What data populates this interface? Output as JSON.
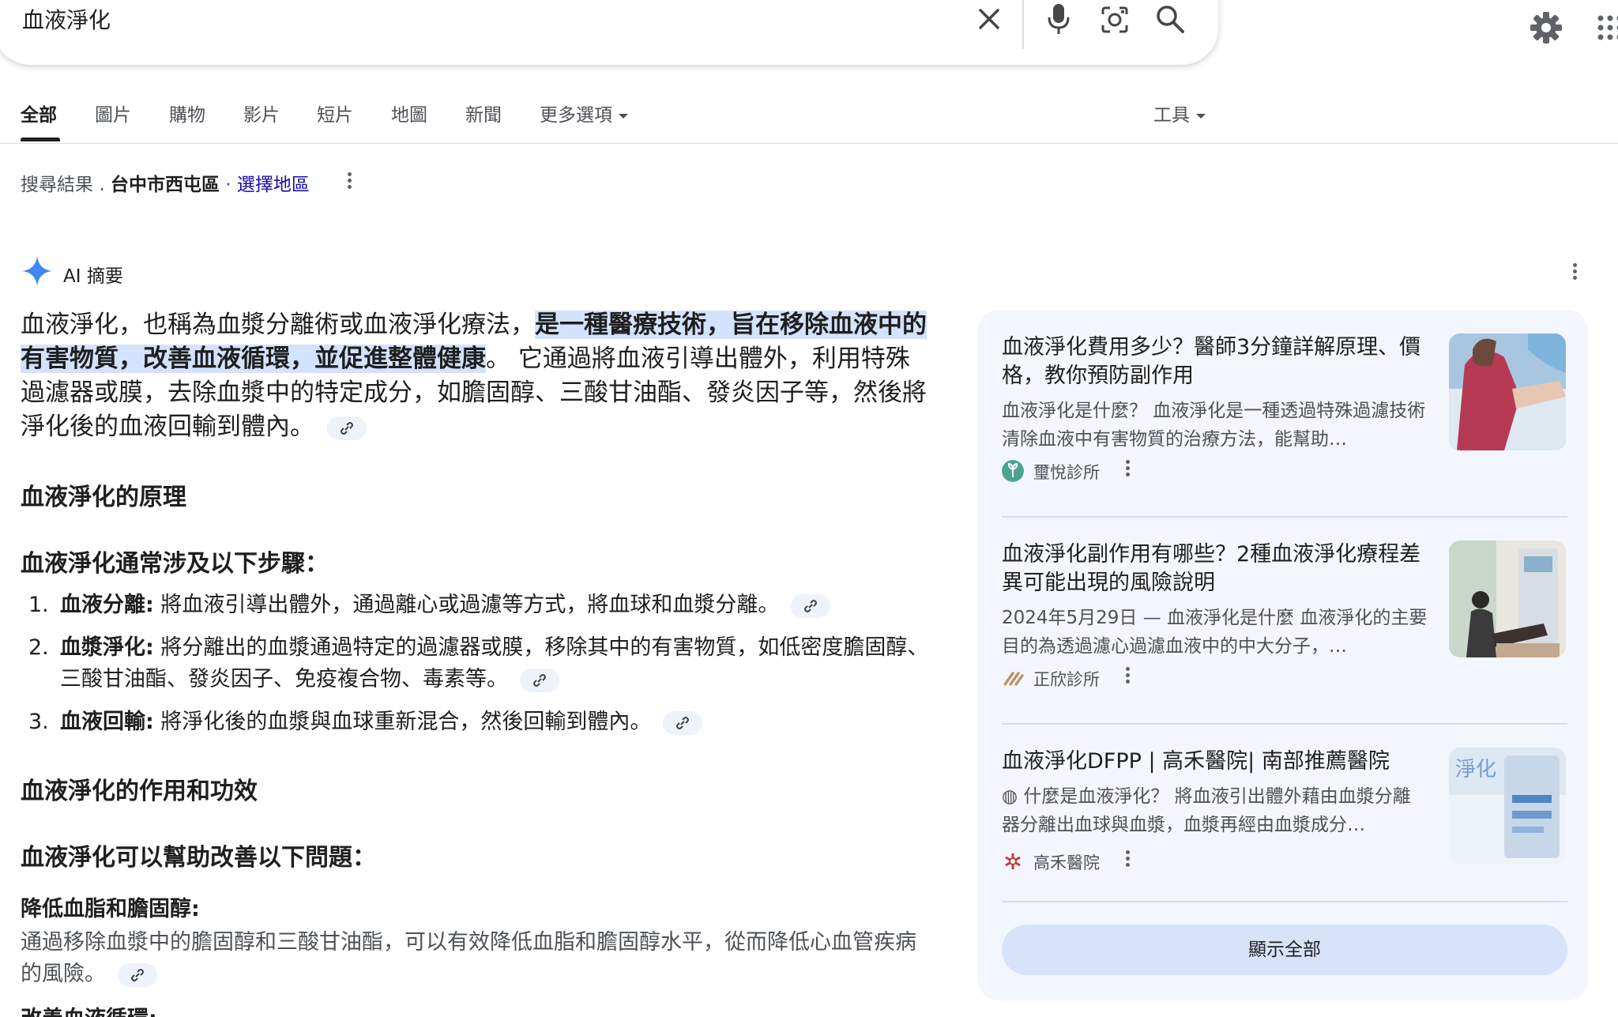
{
  "search": {
    "query": "血液淨化"
  },
  "tabs": [
    {
      "label": "全部"
    },
    {
      "label": "圖片"
    },
    {
      "label": "購物"
    },
    {
      "label": "影片"
    },
    {
      "label": "短片"
    },
    {
      "label": "地圖"
    },
    {
      "label": "新聞"
    },
    {
      "label": "更多選項"
    }
  ],
  "tools_label": "工具",
  "location": {
    "prefix": "搜尋結果",
    "sep": ".",
    "place": "台中市西屯區",
    "dot": "·",
    "choose": "選擇地區"
  },
  "ai_overview": {
    "title": "AI 摘要",
    "intro_a": "血液淨化，也稱為血漿分離術或血液淨化療法，",
    "intro_hl": "是一種醫療技術，旨在移除血液中的有害物質，改善血液循環，並促進整體健康",
    "intro_b": "。 它通過將血液引導出體外，利用特殊過濾器或膜，去除血漿中的特定成分，如膽固醇、三酸甘油酯、發炎因子等，然後將淨化後的血液回輸到體內。",
    "section1": "血液淨化的原理",
    "section1_sub": "血液淨化通常涉及以下步驟：",
    "steps": [
      {
        "num": "1.",
        "term": "血液分離:",
        "text": " 將血液引導出體外，通過離心或過濾等方式，將血球和血漿分離。"
      },
      {
        "num": "2.",
        "term": "血漿淨化:",
        "text": " 將分離出的血漿通過特定的過濾器或膜，移除其中的有害物質，如低密度膽固醇、三酸甘油酯、發炎因子、免疫複合物、毒素等。"
      },
      {
        "num": "3.",
        "term": "血液回輸:",
        "text": " 將淨化後的血漿與血球重新混合，然後回輸到體內。"
      }
    ],
    "section2": "血液淨化的作用和功效",
    "section2_sub": "血液淨化可以幫助改善以下問題：",
    "benefit1_title": "降低血脂和膽固醇:",
    "benefit1_text": "通過移除血漿中的膽固醇和三酸甘油酯，可以有效降低血脂和膽固醇水平，從而降低心血管疾病的風險。",
    "benefit2_title": "改善血液循環:"
  },
  "sources": [
    {
      "title": "血液淨化費用多少？醫師3分鐘詳解原理、價格，教你預防副作用",
      "snippet": "血液淨化是什麼？ 血液淨化是一種透過特殊過濾技術清除血液中有害物質的治療方法，能幫助…",
      "source": "璽悅診所",
      "icon": "leaf-logo-icon"
    },
    {
      "title": "血液淨化副作用有哪些？2種血液淨化療程差異可能出現的風險說明",
      "snippet": "2024年5月29日 — 血液淨化是什麼 血液淨化的主要目的為透過濾心過濾血液中的中大分子，…",
      "source": "正欣診所",
      "icon": "slash-logo-icon"
    },
    {
      "title": "血液淨化DFPP | 高禾醫院| 南部推薦醫院",
      "snippet": "◍ 什麼是血液淨化？ 將血液引出體外藉由血漿分離器分離出血球與血漿，血漿再經由血漿成分…",
      "source": "高禾醫院",
      "icon": "hospital-logo-icon",
      "thumb_text": "淨化"
    }
  ],
  "show_all": "顯示全部",
  "colors": {
    "link": "#1a0dab",
    "highlight": "#d3e3fd",
    "panel": "#f3f6fc",
    "button": "#d7e3f9",
    "spark": "#4285f4"
  }
}
